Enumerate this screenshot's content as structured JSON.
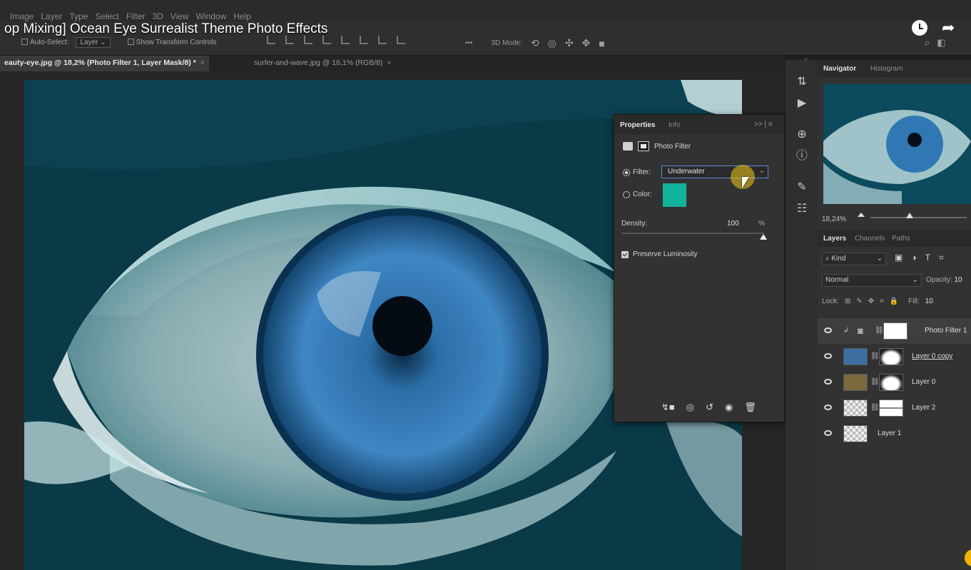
{
  "video_title": "op Mixing] Ocean Eye Surrealist Theme Photo Effects",
  "menu": [
    "Image",
    "Layer",
    "Type",
    "Select",
    "Filter",
    "3D",
    "View",
    "Window",
    "Help"
  ],
  "options": {
    "auto_select": "Auto-Select:",
    "layer_select": "Layer",
    "show_transform": "Show Transform Controls",
    "more": "•••",
    "mode_3d": "3D Mode:"
  },
  "tabs": [
    {
      "label": "eauty-eye.jpg @ 18,2% (Photo Filter 1, Layer Mask/8) *",
      "close": "×"
    },
    {
      "label": "surfer-and-wave.jpg @ 16,1% (RGB/8)",
      "close": "×"
    }
  ],
  "collapse_glyph": "«",
  "properties": {
    "tab_active": "Properties",
    "tab_other": "Info",
    "header_controls": ">> | ≡",
    "adjustment": "Photo Filter",
    "filter_label": "Filter:",
    "filter_value": "Underwater",
    "color_label": "Color:",
    "color_value": "#12b39b",
    "density_label": "Density:",
    "density_value": "100",
    "density_unit": "%",
    "density_level": 1.0,
    "preserve_label": "Preserve Luminosity",
    "preserve_checked": true
  },
  "navigator": {
    "tab_active": "Navigator",
    "tab_other": "Histogram",
    "zoom": "18,24%"
  },
  "layers_panel": {
    "tabs": [
      "Layers",
      "Channels",
      "Paths"
    ],
    "kind": "Kind",
    "blend_mode": "Normal",
    "opacity_label": "Opacity:",
    "opacity_value": "10",
    "lock_label": "Lock:",
    "fill_label": "Fill:",
    "fill_value": "10",
    "layers": [
      {
        "name": "Photo Filter 1",
        "selected": true
      },
      {
        "name": "Layer 0 copy",
        "selected": false
      },
      {
        "name": "Layer 0",
        "selected": false
      },
      {
        "name": "Layer 2",
        "selected": false
      },
      {
        "name": "Layer 1",
        "selected": false
      }
    ]
  },
  "icons": {
    "watch_later": "clock-icon",
    "share": "share-icon"
  }
}
